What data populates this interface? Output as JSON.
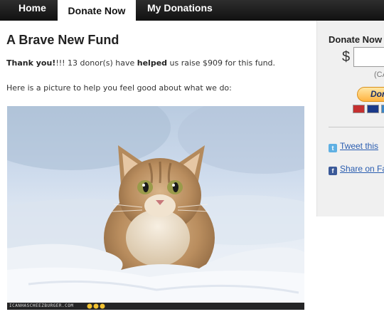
{
  "nav": {
    "tabs": [
      {
        "label": "Home",
        "active": false
      },
      {
        "label": "Donate Now",
        "active": true
      },
      {
        "label": "My Donations",
        "active": false
      }
    ]
  },
  "main": {
    "title": "A Brave New Fund",
    "thanks": {
      "lead": "Thank you!",
      "after_lead": "!!! 13 donor(s) have ",
      "helped": "helped",
      "rest": " us raise $909 for this fund."
    },
    "picture_intro": "Here is a picture to help you feel good about what we do:",
    "photo_credit": "ICANHASCHEEZBURGER.COM"
  },
  "sidebar": {
    "title": "Donate Now w",
    "currency_symbol": "$",
    "amount_value": "",
    "currency_note": "(CA",
    "paypal_label": "Dor",
    "card_icons": [
      "mastercard-icon",
      "visa-icon",
      "amex-icon"
    ],
    "tweet_label": "Tweet this",
    "facebook_label": "Share on Fac"
  },
  "colors": {
    "nav_bg": "#1a1a1a",
    "link": "#2a5db0",
    "sidebar_bg": "#f0f0f0",
    "paypal_button": "#ffb340"
  }
}
